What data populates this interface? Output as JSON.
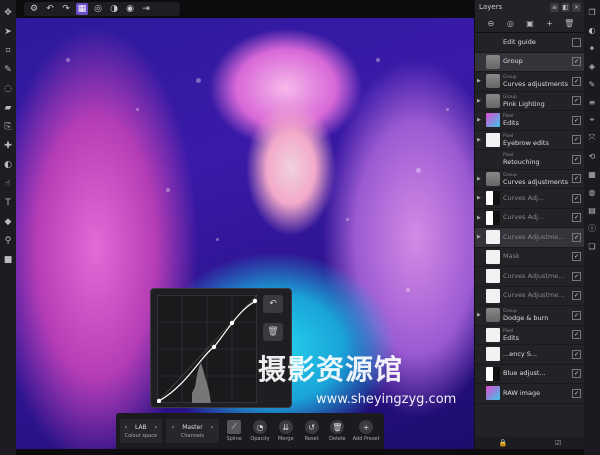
{
  "left_tools": [
    "move-icon",
    "select-icon",
    "crop-icon",
    "brush-icon",
    "selection-brush-icon",
    "paint-icon",
    "clone-icon",
    "healing-icon",
    "dodge-icon",
    "smudge-icon",
    "text-icon",
    "fill-icon",
    "eyedropper-icon",
    "shape-icon"
  ],
  "top_tools": [
    "assistant-icon",
    "undo-icon",
    "redo-icon",
    "pixel-persona-icon",
    "liquify-icon",
    "develop-icon",
    "tone-map-icon",
    "export-icon"
  ],
  "layers": {
    "title": "Layers",
    "rows": [
      {
        "kind": "",
        "label": "Edit guide",
        "check": "",
        "thumb": "",
        "arrow": false,
        "dim": false,
        "sel": false
      },
      {
        "kind": "",
        "label": "Group",
        "check": "✓",
        "thumb": "folder",
        "arrow": false,
        "dim": false,
        "sel": true
      },
      {
        "kind": "Group",
        "label": "Curves adjustments",
        "check": "✓",
        "thumb": "folder",
        "arrow": true,
        "dim": false,
        "sel": false
      },
      {
        "kind": "Group",
        "label": "Pink Lighting",
        "check": "✓",
        "thumb": "folder",
        "arrow": true,
        "dim": false,
        "sel": false
      },
      {
        "kind": "Pixel",
        "label": "Edits",
        "check": "✓",
        "thumb": "pic",
        "arrow": true,
        "dim": false,
        "sel": false
      },
      {
        "kind": "Pixel",
        "label": "Eyebrow edits",
        "check": "✓",
        "thumb": "w",
        "arrow": true,
        "dim": false,
        "sel": false
      },
      {
        "kind": "Pixel",
        "label": "Retouching",
        "check": "✓",
        "thumb": "",
        "arrow": false,
        "dim": false,
        "sel": false
      },
      {
        "kind": "Group",
        "label": "Curves adjustments",
        "check": "✓",
        "thumb": "folder",
        "arrow": true,
        "dim": false,
        "sel": false
      },
      {
        "kind": "",
        "label": "Curves Adj...",
        "check": "✓",
        "thumb": "adj",
        "arrow": true,
        "dim": true,
        "sel": false
      },
      {
        "kind": "",
        "label": "Curves Adj...",
        "check": "✓",
        "thumb": "adj",
        "arrow": true,
        "dim": true,
        "sel": false
      },
      {
        "kind": "",
        "label": "Curves Adjustme...",
        "check": "✓",
        "thumb": "w",
        "arrow": true,
        "dim": true,
        "sel": true
      },
      {
        "kind": "",
        "label": "Mask",
        "check": "✓",
        "thumb": "w",
        "arrow": false,
        "dim": true,
        "sel": false
      },
      {
        "kind": "",
        "label": "Curves Adjustme...",
        "check": "✓",
        "thumb": "w",
        "arrow": false,
        "dim": true,
        "sel": false
      },
      {
        "kind": "",
        "label": "Curves Adjustme...",
        "check": "✓",
        "thumb": "w",
        "arrow": false,
        "dim": true,
        "sel": false
      },
      {
        "kind": "Group",
        "label": "Dodge & burn",
        "check": "✓",
        "thumb": "folder",
        "arrow": true,
        "dim": false,
        "sel": false
      },
      {
        "kind": "Pixel",
        "label": "Edits",
        "check": "✓",
        "thumb": "w",
        "arrow": false,
        "dim": false,
        "sel": false
      },
      {
        "kind": "",
        "label": "...ency S...",
        "check": "✓",
        "thumb": "w",
        "arrow": false,
        "dim": false,
        "sel": false
      },
      {
        "kind": "",
        "label": "Blue adjust...",
        "check": "✓",
        "thumb": "adj",
        "arrow": false,
        "dim": false,
        "sel": false
      },
      {
        "kind": "",
        "label": "RAW image",
        "check": "✓",
        "thumb": "pic",
        "arrow": false,
        "dim": false,
        "sel": false
      }
    ]
  },
  "studio_tools": [
    "layers-icon",
    "adjustments-icon",
    "effects-icon",
    "styles-icon",
    "brushes-icon",
    "channels-icon",
    "navigator-icon",
    "transform-icon",
    "history-icon",
    "swatches-icon",
    "colour-icon",
    "stock-icon",
    "info-icon",
    "snapshots-icon"
  ],
  "ctx": {
    "colour_space": {
      "value": "LAB",
      "caption": "Colour space"
    },
    "channels": {
      "value": "Master",
      "caption": "Channels"
    },
    "spline": "Spline",
    "opacity": "Opacity",
    "merge": "Merge",
    "reset": "Reset",
    "delete": "Delete",
    "add_preset": "Add Preset"
  },
  "watermark": {
    "big": "摄影资源馆",
    "small": "www.sheyingzyg.com"
  }
}
